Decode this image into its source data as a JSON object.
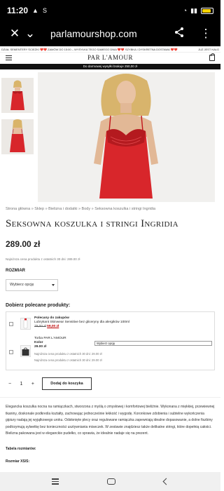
{
  "status": {
    "time": "11:20",
    "carrier_icon": "signal-icon",
    "battery": "93"
  },
  "browser": {
    "url": "parlamourshop.com"
  },
  "ticker": {
    "left": "DZIAŁ SEMENTERY ŚCIEŻKI ❤️❤️ ZAMÓW DO 15:00 – WYSYŁKA TEGO SAMEGO DNIA ❤️❤️ SZYBKA I DYSKRETNA DOSTAWA ❤️❤️",
    "right": "JUŻ JEST KAŁG"
  },
  "header": {
    "logo": "PAR L'AMOUR"
  },
  "shipbar": {
    "text": "Do darmowej wysyłki brakuje 250,00 zł"
  },
  "product": {
    "breadcrumb": "Strona główna » Sklep » Bielizna i dodatki » Body » Seksowna koszulka i stringi Ingridia",
    "title": "Seksowna koszulka i stringi Ingridia",
    "price": "289.00 zł",
    "lowest_price_note": "Najniższa cena produktu z ostatnich 30 dni: 289.00 zł",
    "size_label": "ROZMIAR",
    "size_select": "Wybierz opcję"
  },
  "recommended": {
    "title": "Dobierz polecane produkty:",
    "items": [
      {
        "badge": "Polecany do zakupów",
        "name": "Lubrykant Skinwear Sensitive bez gliceryny dla alergików 100ml",
        "old_price": "79,00 zł",
        "new_price": "59,00 zł"
      },
      {
        "name": "Torba PAR L'AMOUR",
        "color_label": "Kolor",
        "price": "29.00 zł",
        "lowest": "Najniższa cena produktu z ostatnich 30 dni: 29.00 zł",
        "variant_select": "Wybierz opcję"
      }
    ],
    "total_note": "Najniższa cena produktu z ostatnich 30 dni: 29.00 zł"
  },
  "cart": {
    "minus": "−",
    "qty": "1",
    "plus": "+",
    "add_label": "Dodaj do koszyka"
  },
  "description": {
    "text": "Elegancka koszulka nocna na ramiączkach, stworzona z myślą o zmysłowej i komfortowej bieliźnie. Wykonana z miękkiej, przewiewnej tkaniny, doskonale podkreśla kształty, zachowując jednocześnie lekkość i wygodę. Koronkowe zdobienia i subtelne wykończenia gipiury nadają jej wyjątkowego uroku. Odsłonięte plecy oraz regulowane ramiączka zapewniają idealne dopasowanie, a dolne fiszbiny podtrzymują sylwetkę bez konieczności usztywniania miseczek. W zestawie znajdziesz także delikatne stringi, które dopełnią całości. Bielizna pakowana jest w eleganckie pudełko, co sprawia, że idealnie nadaje się na prezent.",
    "sizes_heading": "Tabela rozmiarów:",
    "size_xs": "Rozmiar XS/S:"
  },
  "colors": {
    "accent_red": "#d8262b",
    "dark": "#111111"
  }
}
